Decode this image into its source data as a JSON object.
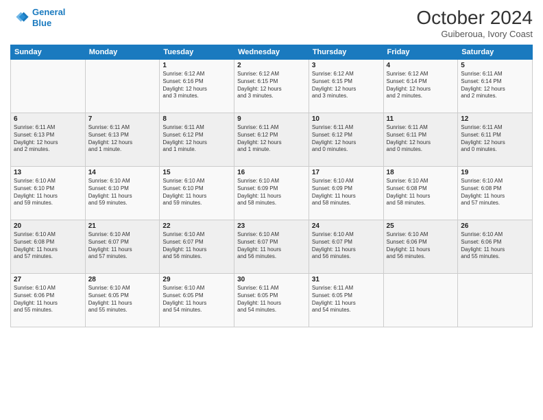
{
  "header": {
    "logo_line1": "General",
    "logo_line2": "Blue",
    "month": "October 2024",
    "location": "Guiberoua, Ivory Coast"
  },
  "weekdays": [
    "Sunday",
    "Monday",
    "Tuesday",
    "Wednesday",
    "Thursday",
    "Friday",
    "Saturday"
  ],
  "weeks": [
    [
      {
        "day": "",
        "text": ""
      },
      {
        "day": "",
        "text": ""
      },
      {
        "day": "1",
        "text": "Sunrise: 6:12 AM\nSunset: 6:16 PM\nDaylight: 12 hours\nand 3 minutes."
      },
      {
        "day": "2",
        "text": "Sunrise: 6:12 AM\nSunset: 6:15 PM\nDaylight: 12 hours\nand 3 minutes."
      },
      {
        "day": "3",
        "text": "Sunrise: 6:12 AM\nSunset: 6:15 PM\nDaylight: 12 hours\nand 3 minutes."
      },
      {
        "day": "4",
        "text": "Sunrise: 6:12 AM\nSunset: 6:14 PM\nDaylight: 12 hours\nand 2 minutes."
      },
      {
        "day": "5",
        "text": "Sunrise: 6:11 AM\nSunset: 6:14 PM\nDaylight: 12 hours\nand 2 minutes."
      }
    ],
    [
      {
        "day": "6",
        "text": "Sunrise: 6:11 AM\nSunset: 6:13 PM\nDaylight: 12 hours\nand 2 minutes."
      },
      {
        "day": "7",
        "text": "Sunrise: 6:11 AM\nSunset: 6:13 PM\nDaylight: 12 hours\nand 1 minute."
      },
      {
        "day": "8",
        "text": "Sunrise: 6:11 AM\nSunset: 6:12 PM\nDaylight: 12 hours\nand 1 minute."
      },
      {
        "day": "9",
        "text": "Sunrise: 6:11 AM\nSunset: 6:12 PM\nDaylight: 12 hours\nand 1 minute."
      },
      {
        "day": "10",
        "text": "Sunrise: 6:11 AM\nSunset: 6:12 PM\nDaylight: 12 hours\nand 0 minutes."
      },
      {
        "day": "11",
        "text": "Sunrise: 6:11 AM\nSunset: 6:11 PM\nDaylight: 12 hours\nand 0 minutes."
      },
      {
        "day": "12",
        "text": "Sunrise: 6:11 AM\nSunset: 6:11 PM\nDaylight: 12 hours\nand 0 minutes."
      }
    ],
    [
      {
        "day": "13",
        "text": "Sunrise: 6:10 AM\nSunset: 6:10 PM\nDaylight: 11 hours\nand 59 minutes."
      },
      {
        "day": "14",
        "text": "Sunrise: 6:10 AM\nSunset: 6:10 PM\nDaylight: 11 hours\nand 59 minutes."
      },
      {
        "day": "15",
        "text": "Sunrise: 6:10 AM\nSunset: 6:10 PM\nDaylight: 11 hours\nand 59 minutes."
      },
      {
        "day": "16",
        "text": "Sunrise: 6:10 AM\nSunset: 6:09 PM\nDaylight: 11 hours\nand 58 minutes."
      },
      {
        "day": "17",
        "text": "Sunrise: 6:10 AM\nSunset: 6:09 PM\nDaylight: 11 hours\nand 58 minutes."
      },
      {
        "day": "18",
        "text": "Sunrise: 6:10 AM\nSunset: 6:08 PM\nDaylight: 11 hours\nand 58 minutes."
      },
      {
        "day": "19",
        "text": "Sunrise: 6:10 AM\nSunset: 6:08 PM\nDaylight: 11 hours\nand 57 minutes."
      }
    ],
    [
      {
        "day": "20",
        "text": "Sunrise: 6:10 AM\nSunset: 6:08 PM\nDaylight: 11 hours\nand 57 minutes."
      },
      {
        "day": "21",
        "text": "Sunrise: 6:10 AM\nSunset: 6:07 PM\nDaylight: 11 hours\nand 57 minutes."
      },
      {
        "day": "22",
        "text": "Sunrise: 6:10 AM\nSunset: 6:07 PM\nDaylight: 11 hours\nand 56 minutes."
      },
      {
        "day": "23",
        "text": "Sunrise: 6:10 AM\nSunset: 6:07 PM\nDaylight: 11 hours\nand 56 minutes."
      },
      {
        "day": "24",
        "text": "Sunrise: 6:10 AM\nSunset: 6:07 PM\nDaylight: 11 hours\nand 56 minutes."
      },
      {
        "day": "25",
        "text": "Sunrise: 6:10 AM\nSunset: 6:06 PM\nDaylight: 11 hours\nand 56 minutes."
      },
      {
        "day": "26",
        "text": "Sunrise: 6:10 AM\nSunset: 6:06 PM\nDaylight: 11 hours\nand 55 minutes."
      }
    ],
    [
      {
        "day": "27",
        "text": "Sunrise: 6:10 AM\nSunset: 6:06 PM\nDaylight: 11 hours\nand 55 minutes."
      },
      {
        "day": "28",
        "text": "Sunrise: 6:10 AM\nSunset: 6:05 PM\nDaylight: 11 hours\nand 55 minutes."
      },
      {
        "day": "29",
        "text": "Sunrise: 6:10 AM\nSunset: 6:05 PM\nDaylight: 11 hours\nand 54 minutes."
      },
      {
        "day": "30",
        "text": "Sunrise: 6:11 AM\nSunset: 6:05 PM\nDaylight: 11 hours\nand 54 minutes."
      },
      {
        "day": "31",
        "text": "Sunrise: 6:11 AM\nSunset: 6:05 PM\nDaylight: 11 hours\nand 54 minutes."
      },
      {
        "day": "",
        "text": ""
      },
      {
        "day": "",
        "text": ""
      }
    ]
  ]
}
